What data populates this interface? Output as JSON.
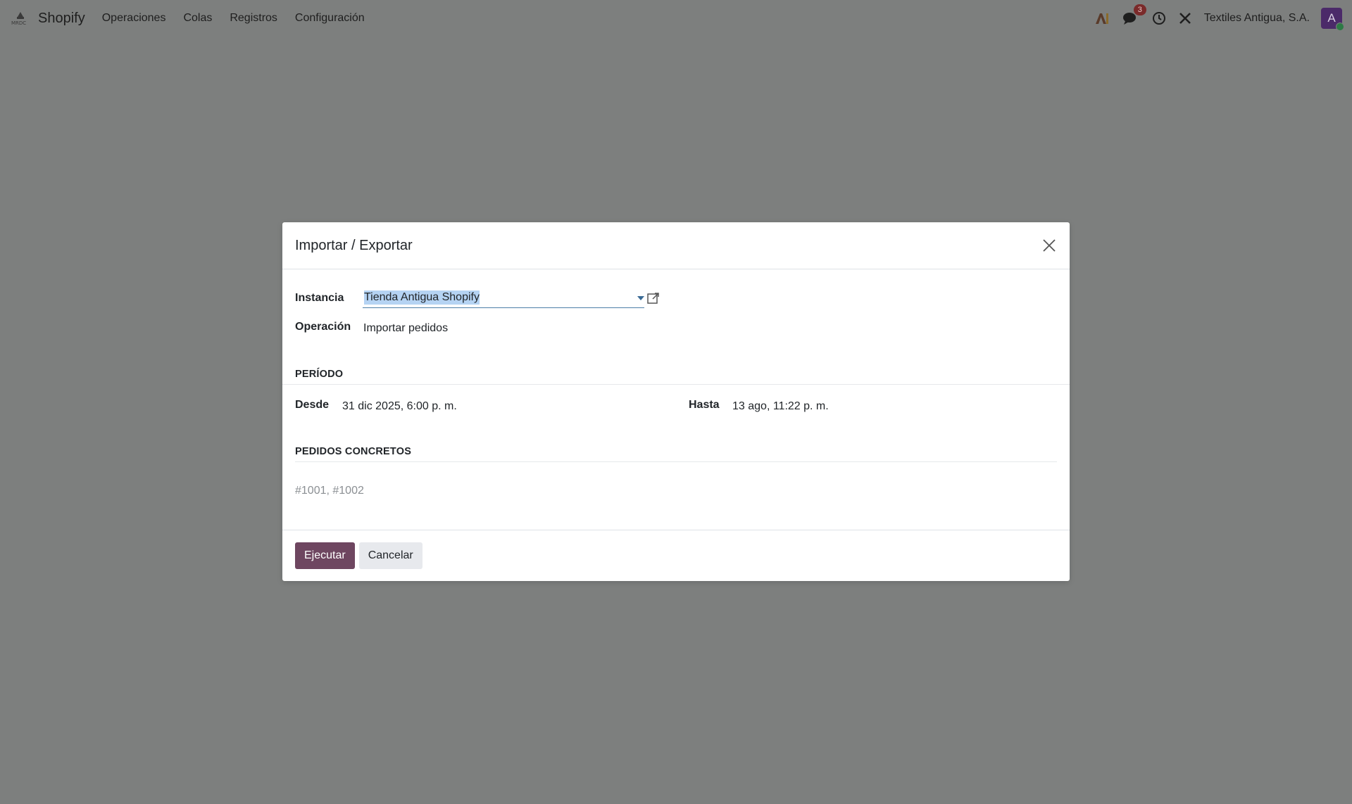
{
  "navbar": {
    "app_name": "Shopify",
    "menu": [
      "Operaciones",
      "Colas",
      "Registros",
      "Configuración"
    ],
    "chat_badge": "3",
    "company": "Textiles Antigua, S.A.",
    "avatar_initial": "A"
  },
  "dialog": {
    "title": "Importar / Exportar",
    "instance_label": "Instancia",
    "instance_value": "Tienda Antigua Shopify",
    "operation_label": "Operación",
    "operation_value": "Importar pedidos",
    "period_section": "PERÍODO",
    "from_label": "Desde",
    "from_value": "31 dic 2025, 6:00 p. m.",
    "to_label": "Hasta",
    "to_value": "13 ago, 11:22 p. m.",
    "orders_section": "PEDIDOS CONCRETOS",
    "orders_placeholder": "#1001, #1002",
    "run_button": "Ejecutar",
    "cancel_button": "Cancelar"
  },
  "colors": {
    "primary": "#6e4660",
    "overlay": "#7d7f7e",
    "selection": "#b5d3f3"
  }
}
